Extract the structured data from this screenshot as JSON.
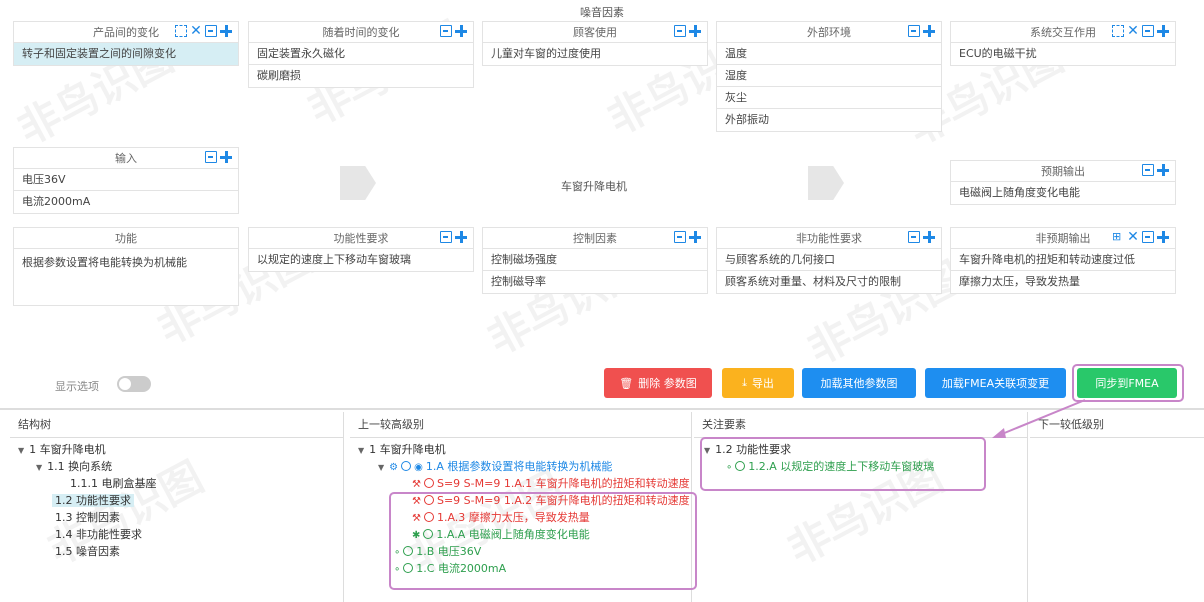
{
  "noise_title": "噪音因素",
  "top_row": [
    {
      "title": "产品间的变化",
      "icons": [
        "select-icon",
        "close-icon",
        "save-icon",
        "add-icon"
      ],
      "rows": [
        "转子和固定装置之间的间隙变化"
      ],
      "selected": 0
    },
    {
      "title": "随着时间的变化",
      "icons": [
        "save-icon",
        "add-icon"
      ],
      "rows": [
        "固定装置永久磁化",
        "碳刷磨损"
      ]
    },
    {
      "title": "顾客使用",
      "icons": [
        "save-icon",
        "add-icon"
      ],
      "rows": [
        "儿童对车窗的过度使用"
      ]
    },
    {
      "title": "外部环境",
      "icons": [
        "save-icon",
        "add-icon"
      ],
      "rows": [
        "温度",
        "湿度",
        "灰尘",
        "外部振动"
      ]
    },
    {
      "title": "系统交互作用",
      "icons": [
        "select-icon",
        "close-icon",
        "save-icon",
        "add-icon"
      ],
      "rows": [
        "ECU的电磁干扰"
      ]
    }
  ],
  "input_card": {
    "title": "输入",
    "rows": [
      "电压36V",
      "电流2000mA"
    ]
  },
  "center_label": "车窗升降电机",
  "expected_output": {
    "title": "预期输出",
    "rows": [
      "电磁阀上随角度变化电能"
    ]
  },
  "bottom_row": [
    {
      "title": "功能",
      "rows": [
        "根据参数设置将电能转换为机械能"
      ]
    },
    {
      "title": "功能性要求",
      "rows": [
        "以规定的速度上下移动车窗玻璃"
      ]
    },
    {
      "title": "控制因素",
      "rows": [
        "控制磁场强度",
        "控制磁导率"
      ]
    },
    {
      "title": "非功能性要求",
      "rows": [
        "与顾客系统的几何接口",
        "顾客系统对重量、材料及尺寸的限制"
      ]
    },
    {
      "title": "非预期输出",
      "rows": [
        "车窗升降电机的扭矩和转动速度过低",
        "摩擦力太压，导致发热量"
      ]
    }
  ],
  "options": {
    "label": "显示选项"
  },
  "buttons": {
    "delete": "删除 参数图",
    "export": "导出",
    "load_other": "加载其他参数图",
    "load_fmea": "加载FMEA关联项变更",
    "sync": "同步到FMEA"
  },
  "colors": {
    "delete": "#f0504f",
    "export": "#fbb21e",
    "load": "#1e8ef0",
    "sync": "#29c86a",
    "highlight": "#c886c9"
  },
  "panels": {
    "structure": {
      "header": "结构树",
      "items": [
        "1 车窗升降电机",
        "1.1 换向系统",
        "1.1.1 电刷盒基座",
        "1.2 功能性要求",
        "1.3 控制因素",
        "1.4 非功能性要求",
        "1.5 噪音因素"
      ]
    },
    "higher": {
      "header": "上一较高级别",
      "root": "1 车窗升降电机",
      "func": "1.A 根据参数设置将电能转换为机械能",
      "fail1": "S=9 S-M=9 1.A.1 车窗升降电机的扭矩和转动速度",
      "fail2": "S=9 S-M=9 1.A.2 车窗升降电机的扭矩和转动速度",
      "fail3": "1.A.3 摩擦力太压，导致发热量",
      "out": "1.A.A 电磁阀上随角度变化电能",
      "in1": "1.B 电压36V",
      "in2": "1.C 电流2000mA"
    },
    "focus": {
      "header": "关注要素",
      "root": "1.2 功能性要求",
      "item": "1.2.A 以规定的速度上下移动车窗玻璃"
    },
    "lower": {
      "header": "下一较低级别"
    }
  }
}
